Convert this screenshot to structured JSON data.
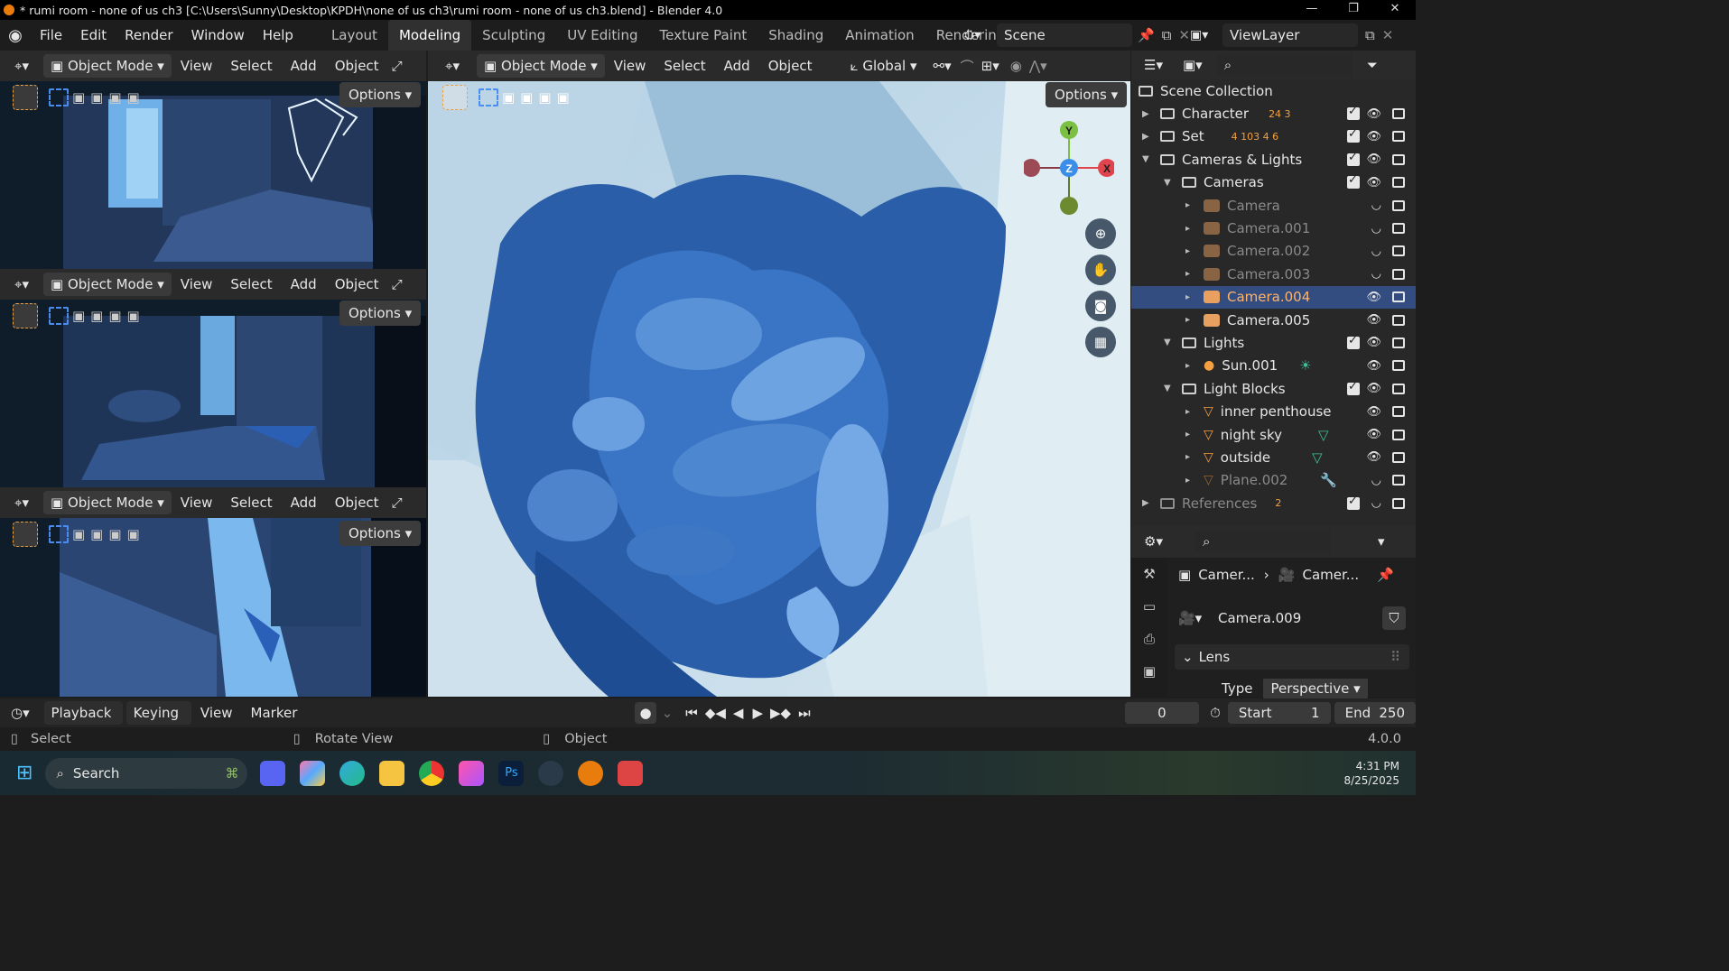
{
  "titlebar": {
    "title": "* rumi room - none of us ch3 [C:\\Users\\Sunny\\Desktop\\KPDH\\none of us ch3\\rumi room - none of us ch3.blend] - Blender 4.0"
  },
  "menus": [
    "File",
    "Edit",
    "Render",
    "Window",
    "Help"
  ],
  "workspaces": [
    "Layout",
    "Modeling",
    "Sculpting",
    "UV Editing",
    "Texture Paint",
    "Shading",
    "Animation",
    "Rendering"
  ],
  "active_workspace": "Modeling",
  "scene_field": "Scene",
  "viewlayer_field": "ViewLayer",
  "viewport": {
    "mode": "Object Mode",
    "menus": [
      "View",
      "Select",
      "Add",
      "Object"
    ],
    "orientation": "Global",
    "options": "Options",
    "gizmo": {
      "y": "Y",
      "z": "Z",
      "x": "X"
    }
  },
  "outliner": {
    "title": "Scene Collection",
    "rows": [
      {
        "name": "Character",
        "badges": "24 3"
      },
      {
        "name": "Set",
        "badges": "4 103 4 6"
      },
      {
        "name": "Cameras & Lights"
      },
      {
        "name": "Cameras"
      },
      {
        "name": "Camera"
      },
      {
        "name": "Camera.001"
      },
      {
        "name": "Camera.002"
      },
      {
        "name": "Camera.003"
      },
      {
        "name": "Camera.004"
      },
      {
        "name": "Camera.005"
      },
      {
        "name": "Lights"
      },
      {
        "name": "Sun.001"
      },
      {
        "name": "Light Blocks"
      },
      {
        "name": "inner penthouse"
      },
      {
        "name": "night sky"
      },
      {
        "name": "outside"
      },
      {
        "name": "Plane.002"
      },
      {
        "name": "References",
        "badges": "2"
      }
    ]
  },
  "properties": {
    "breadcrumb_a": "Camer...",
    "breadcrumb_b": "Camer...",
    "data_name": "Camera.009",
    "panel": "Lens",
    "type_label": "Type",
    "type_value": "Perspective"
  },
  "timeline": {
    "menus": [
      "Playback",
      "Keying",
      "View",
      "Marker"
    ],
    "current_frame": "0",
    "start_label": "Start",
    "start_value": "1",
    "end_label": "End",
    "end_value": "250"
  },
  "statusbar": {
    "select": "Select",
    "rotate": "Rotate View",
    "object": "Object",
    "version": "4.0.0"
  },
  "taskbar": {
    "search": "Search",
    "time": "4:31 PM",
    "date": "8/25/2025"
  }
}
